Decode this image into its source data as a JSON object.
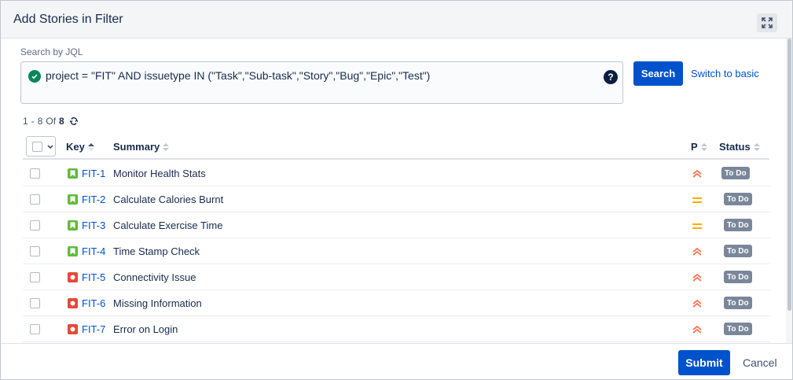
{
  "dialog": {
    "title": "Add Stories in Filter"
  },
  "jql": {
    "label": "Search by JQL",
    "query": "project = \"FIT\" AND issuetype IN (\"Task\",\"Sub-task\",\"Story\",\"Bug\",\"Epic\",\"Test\")",
    "help": "?",
    "search_label": "Search",
    "switch_label": "Switch to basic"
  },
  "results": {
    "range_start": "1",
    "range_sep": "-",
    "range_end": "8",
    "of_label": "Of",
    "total": "8"
  },
  "table": {
    "columns": {
      "key": "Key",
      "summary": "Summary",
      "priority": "P",
      "status": "Status"
    },
    "rows": [
      {
        "type": "story",
        "key": "FIT-1",
        "summary": "Monitor Health Stats",
        "priority": "high",
        "status": "To Do"
      },
      {
        "type": "story",
        "key": "FIT-2",
        "summary": "Calculate Calories Burnt",
        "priority": "medium",
        "status": "To Do"
      },
      {
        "type": "story",
        "key": "FIT-3",
        "summary": "Calculate Exercise Time",
        "priority": "medium",
        "status": "To Do"
      },
      {
        "type": "story",
        "key": "FIT-4",
        "summary": "Time Stamp Check",
        "priority": "high",
        "status": "To Do"
      },
      {
        "type": "bug",
        "key": "FIT-5",
        "summary": "Connectivity Issue",
        "priority": "high",
        "status": "To Do"
      },
      {
        "type": "bug",
        "key": "FIT-6",
        "summary": "Missing Information",
        "priority": "high",
        "status": "To Do"
      },
      {
        "type": "bug",
        "key": "FIT-7",
        "summary": "Error on Login",
        "priority": "high",
        "status": "To Do"
      }
    ]
  },
  "footer": {
    "submit_label": "Submit",
    "cancel_label": "Cancel"
  },
  "colors": {
    "primary": "#0052cc",
    "story": "#63ba3c",
    "bug": "#e5493a",
    "priority_high": "#ff7452",
    "priority_medium": "#ffab00",
    "status_todo": "#7a869a",
    "jql_valid": "#00875a"
  }
}
